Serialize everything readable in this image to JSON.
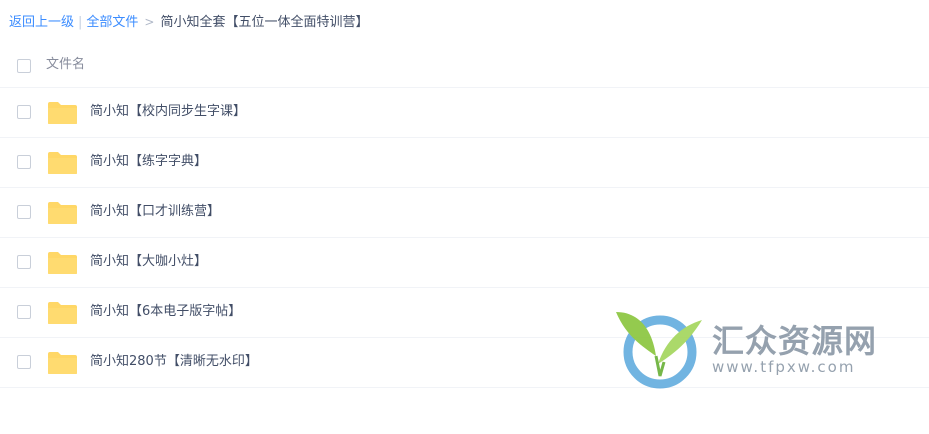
{
  "breadcrumb": {
    "back": "返回上一级",
    "separator": "|",
    "all_files": "全部文件",
    "arrow": ">",
    "current": "简小知全套【五位一体全面特训营】"
  },
  "list": {
    "header": {
      "name_column": "文件名"
    },
    "rows": [
      {
        "name": "简小知【校内同步生字课】",
        "type": "folder"
      },
      {
        "name": "简小知【练字字典】",
        "type": "folder"
      },
      {
        "name": "简小知【口才训练营】",
        "type": "folder"
      },
      {
        "name": "简小知【大咖小灶】",
        "type": "folder"
      },
      {
        "name": "简小知【6本电子版字帖】",
        "type": "folder"
      },
      {
        "name": "简小知280节【清晰无水印】",
        "type": "folder"
      }
    ]
  },
  "watermark": {
    "title": "汇众资源网",
    "url": "www.tfpxw.com"
  },
  "colors": {
    "link": "#3b8cff",
    "text": "#424e67",
    "folder": "#ffd766",
    "watermark_green": "#8cc63f",
    "watermark_blue": "#4a9fd8"
  }
}
